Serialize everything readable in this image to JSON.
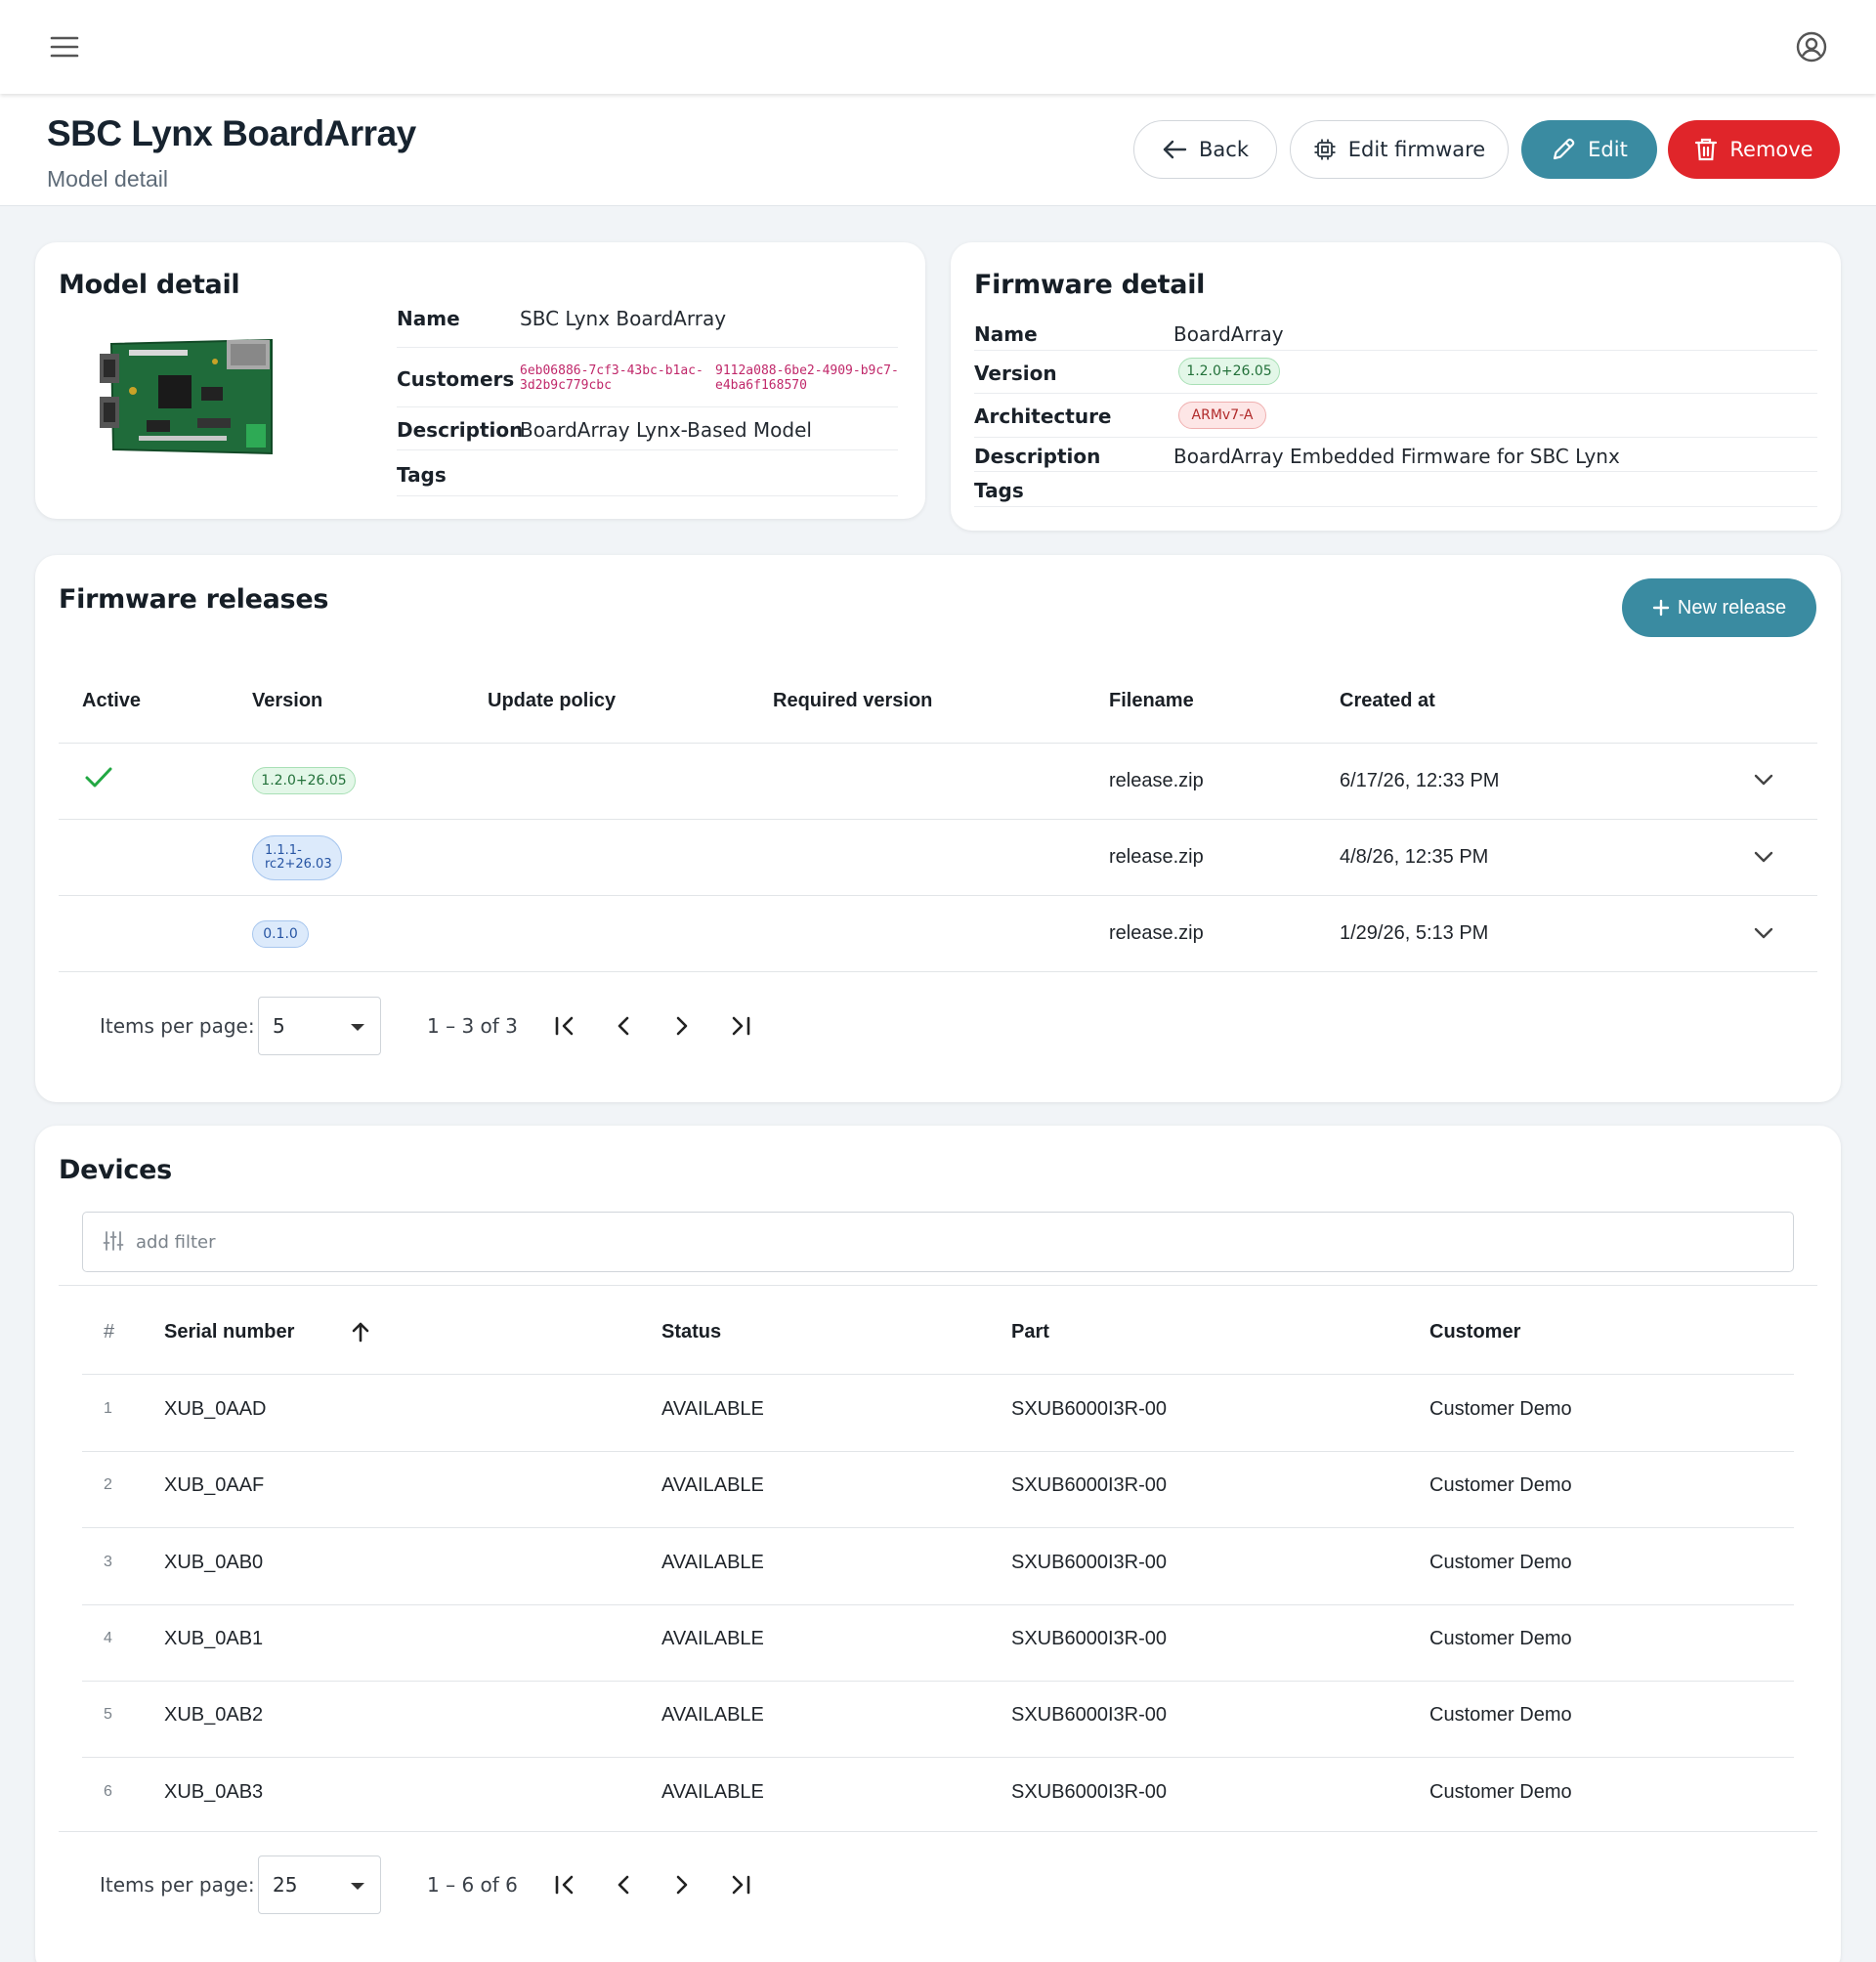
{
  "header": {
    "title": "SBC Lynx BoardArray",
    "subtitle": "Model detail",
    "back_label": "Back",
    "edit_firmware_label": "Edit firmware",
    "edit_label": "Edit",
    "remove_label": "Remove"
  },
  "model_detail": {
    "title": "Model detail",
    "name_label": "Name",
    "name_value": "SBC Lynx BoardArray",
    "customers_label": "Customers",
    "customers": [
      [
        "6eb06886-7cf3-43bc-b1ac-",
        "3d2b9c779cbc"
      ],
      [
        "9112a088-6be2-4909-b9c7-",
        "e4ba6f168570"
      ]
    ],
    "description_label": "Description",
    "description_value": "BoardArray Lynx-Based Model",
    "tags_label": "Tags"
  },
  "firmware_detail": {
    "title": "Firmware detail",
    "name_label": "Name",
    "name_value": "BoardArray",
    "version_label": "Version",
    "version_value": "1.2.0+26.05",
    "architecture_label": "Architecture",
    "architecture_value": "ARMv7-A",
    "description_label": "Description",
    "description_value": "BoardArray Embedded Firmware for SBC Lynx",
    "tags_label": "Tags"
  },
  "releases": {
    "title": "Firmware releases",
    "new_release_label": "New release",
    "columns": [
      "Active",
      "Version",
      "Update policy",
      "Required version",
      "Filename",
      "Created at"
    ],
    "rows": [
      {
        "active": true,
        "version": "1.2.0+26.05",
        "version_lines": [
          "1.2.0+26.05"
        ],
        "filename": "release.zip",
        "created": "6/17/26, 12:33 PM"
      },
      {
        "active": false,
        "version": "1.1.1-rc2+26.03",
        "version_lines": [
          "1.1.1-",
          "rc2+26.03"
        ],
        "filename": "release.zip",
        "created": "4/8/26, 12:35 PM"
      },
      {
        "active": false,
        "version": "0.1.0",
        "version_lines": [
          "0.1.0"
        ],
        "filename": "release.zip",
        "created": "1/29/26, 5:13 PM"
      }
    ],
    "pager": {
      "items_per_page_label": "Items per page:",
      "page_size": "5",
      "range": "1 – 3 of 3"
    }
  },
  "devices": {
    "title": "Devices",
    "filter_placeholder": "add filter",
    "columns": [
      "#",
      "Serial number",
      "Status",
      "Part",
      "Customer"
    ],
    "rows": [
      {
        "n": "1",
        "serial": "XUB_0AAD",
        "status": "AVAILABLE",
        "part": "SXUB6000I3R-00",
        "customer": "Customer Demo"
      },
      {
        "n": "2",
        "serial": "XUB_0AAF",
        "status": "AVAILABLE",
        "part": "SXUB6000I3R-00",
        "customer": "Customer Demo"
      },
      {
        "n": "3",
        "serial": "XUB_0AB0",
        "status": "AVAILABLE",
        "part": "SXUB6000I3R-00",
        "customer": "Customer Demo"
      },
      {
        "n": "4",
        "serial": "XUB_0AB1",
        "status": "AVAILABLE",
        "part": "SXUB6000I3R-00",
        "customer": "Customer Demo"
      },
      {
        "n": "5",
        "serial": "XUB_0AB2",
        "status": "AVAILABLE",
        "part": "SXUB6000I3R-00",
        "customer": "Customer Demo"
      },
      {
        "n": "6",
        "serial": "XUB_0AB3",
        "status": "AVAILABLE",
        "part": "SXUB6000I3R-00",
        "customer": "Customer Demo"
      }
    ],
    "pager": {
      "items_per_page_label": "Items per page:",
      "page_size": "25",
      "range": "1 – 6 of 6"
    }
  },
  "icons": {
    "menu": "menu-icon",
    "account": "account-circle-icon",
    "back": "arrow-left-icon",
    "edit_firmware": "chip-icon",
    "edit": "pencil-icon",
    "remove": "trash-icon",
    "active": "check-icon",
    "expand": "chevron-down-icon",
    "filter": "sliders-icon",
    "sort": "arrow-up-icon"
  },
  "colors": {
    "accent": "#3a8ba1",
    "danger": "#e0252a",
    "active_check": "#22a843"
  }
}
